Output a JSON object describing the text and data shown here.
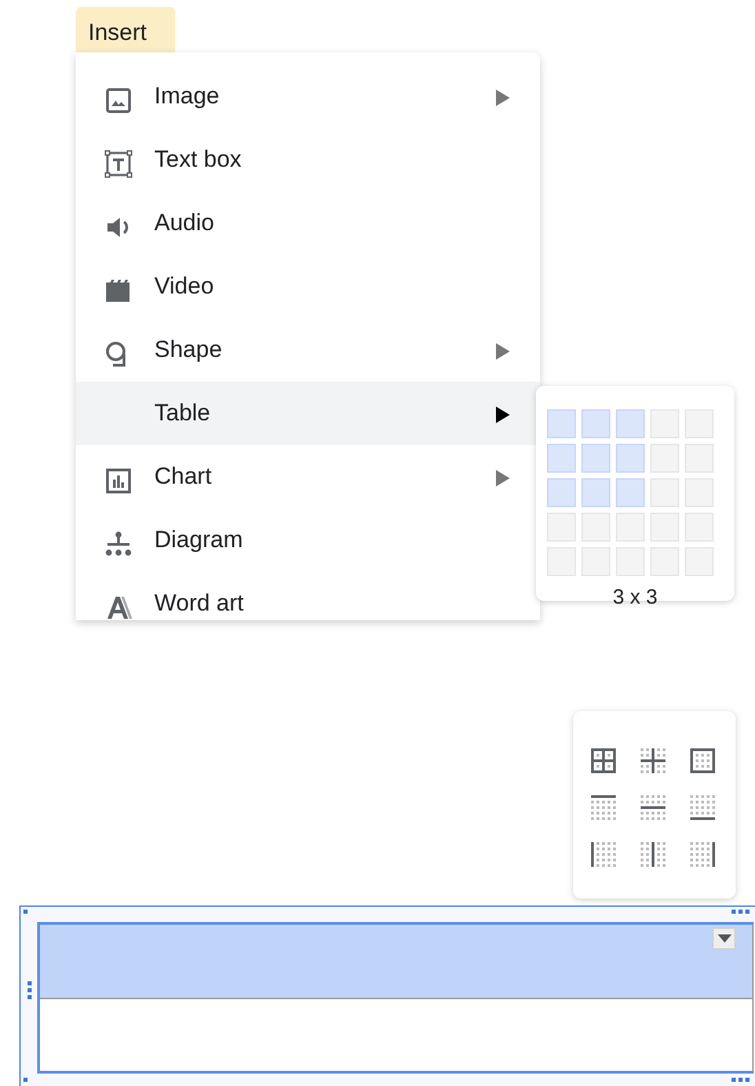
{
  "menu_tab": {
    "label": "Insert"
  },
  "menu": {
    "items": [
      {
        "label": "Image",
        "submenu": true,
        "selected": false
      },
      {
        "label": "Text box",
        "submenu": false,
        "selected": false
      },
      {
        "label": "Audio",
        "submenu": false,
        "selected": false
      },
      {
        "label": "Video",
        "submenu": false,
        "selected": false
      },
      {
        "label": "Shape",
        "submenu": true,
        "selected": false
      },
      {
        "label": "Table",
        "submenu": true,
        "selected": true
      },
      {
        "label": "Chart",
        "submenu": true,
        "selected": false
      },
      {
        "label": "Diagram",
        "submenu": false,
        "selected": false
      },
      {
        "label": "Word art",
        "submenu": false,
        "selected": false
      }
    ]
  },
  "table_picker": {
    "size_label": "3 x 3",
    "rows": [
      [
        {
          "selected": true
        },
        {
          "selected": true
        },
        {
          "selected": true
        },
        {
          "selected": false
        },
        {
          "selected": false
        }
      ],
      [
        {
          "selected": true
        },
        {
          "selected": true
        },
        {
          "selected": true
        },
        {
          "selected": false
        },
        {
          "selected": false
        }
      ],
      [
        {
          "selected": true
        },
        {
          "selected": true
        },
        {
          "selected": true
        },
        {
          "selected": false
        },
        {
          "selected": false
        }
      ],
      [
        {
          "selected": false
        },
        {
          "selected": false
        },
        {
          "selected": false
        },
        {
          "selected": false
        },
        {
          "selected": false
        }
      ],
      [
        {
          "selected": false
        },
        {
          "selected": false
        },
        {
          "selected": false
        },
        {
          "selected": false
        },
        {
          "selected": false
        }
      ]
    ]
  },
  "table": {
    "rows": [
      {
        "selected": true
      },
      {
        "selected": false
      }
    ]
  }
}
